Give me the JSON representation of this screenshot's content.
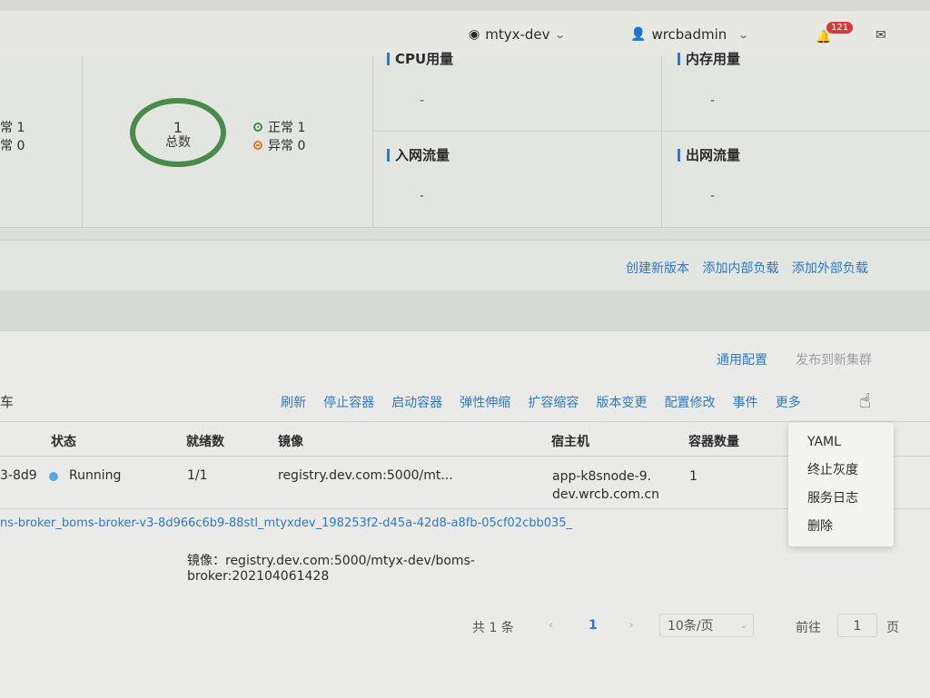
{
  "header": {
    "namespace": "mtyx-dev",
    "user": "wrcbadmin",
    "notification_count": "121"
  },
  "stats": {
    "left_normal": "常 1",
    "left_abnormal": "常 0",
    "total_value": "1",
    "total_label": "总数",
    "normal_label": "正常 1",
    "abnormal_label": "异常 0",
    "cpu_label": "CPU用量",
    "mem_label": "内存用量",
    "in_label": "入网流量",
    "out_label": "出网流量",
    "cpu_value": "-",
    "mem_value": "-",
    "in_value": "-",
    "out_value": "-",
    "colors": {
      "ok": "#3d8b48",
      "bad": "#e07a2e",
      "ring": "#4a8a4a"
    }
  },
  "version_actions": [
    "创建新版本",
    "添加内部负载",
    "添加外部负载"
  ],
  "config_actions": {
    "general": "通用配置",
    "publish": "发布到新集群"
  },
  "section_letter": "车",
  "toolbar": [
    "刷新",
    "停止容器",
    "启动容器",
    "弹性伸缩",
    "扩容缩容",
    "版本变更",
    "配置修改",
    "事件",
    "更多"
  ],
  "table": {
    "headers": [
      "状态",
      "就绪数",
      "镜像",
      "宿主机",
      "容器数量"
    ],
    "row": {
      "name_tail": "3-8d9",
      "status": "Running",
      "ready": "1/1",
      "image": "registry.dev.com:5000/mt...",
      "host_line1": "app-k8snode-9.",
      "host_line2": "dev.wrcb.com.cn",
      "containers": "1"
    },
    "pod_full_name": "ns-broker_boms-broker-v3-8d966c6b9-88stl_mtyxdev_198253f2-d45a-42d8-a8fb-05cf02cbb035_",
    "image_detail_line1": "镜像：registry.dev.com:5000/mtyx-dev/boms-",
    "image_detail_line2": "broker:202104061428"
  },
  "pagination": {
    "total": "共 1 条",
    "current_page": "1",
    "page_size": "10条/页",
    "goto_label": "前往",
    "goto_value": "1",
    "page_unit": "页"
  },
  "more_menu": [
    "YAML",
    "终止灰度",
    "服务日志",
    "删除"
  ],
  "accent": "#2f79c9"
}
